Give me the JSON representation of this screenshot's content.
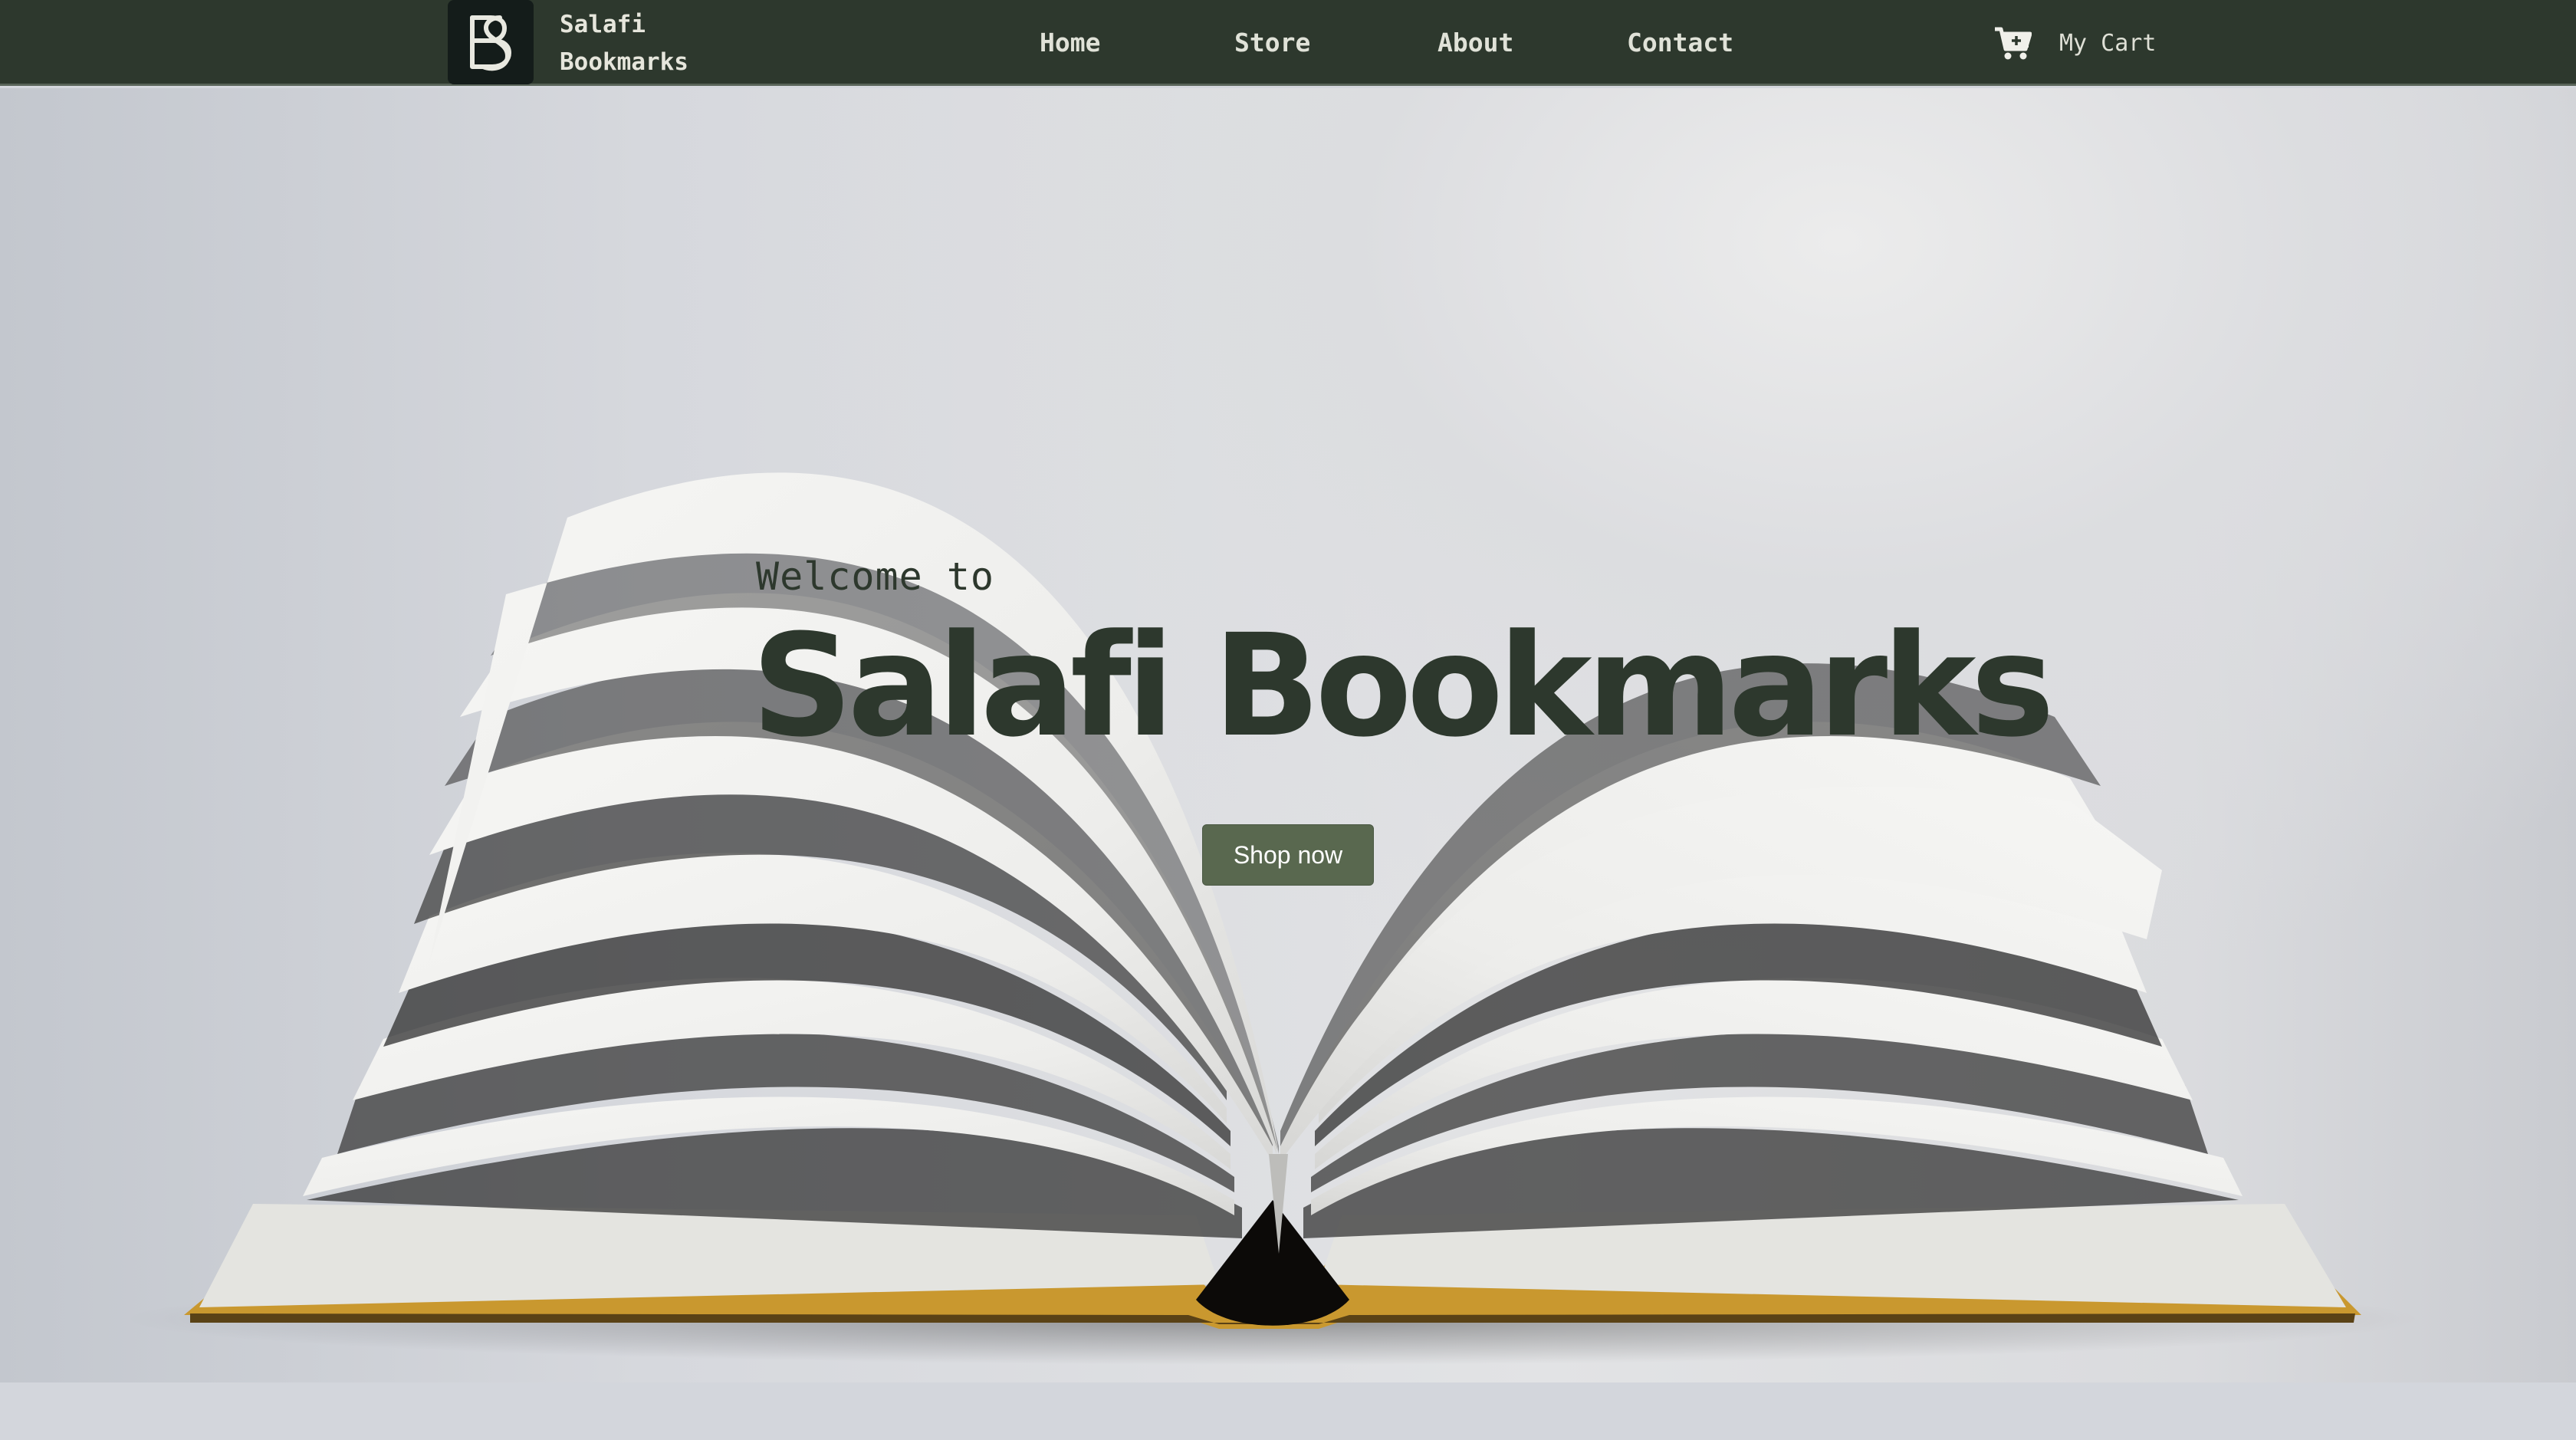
{
  "navbar": {
    "brand_line1": "Salafi",
    "brand_line2": "Bookmarks",
    "logo_icon": "bs-monogram-icon",
    "links": [
      {
        "label": "Home"
      },
      {
        "label": "Store"
      },
      {
        "label": "About"
      },
      {
        "label": "Contact"
      }
    ],
    "cart_icon": "shopping-cart-icon",
    "cart_label": "My Cart"
  },
  "hero": {
    "welcome": "Welcome to",
    "title": "Salafi Bookmarks",
    "cta_label": "Shop now",
    "background_image": "open-book-illustration"
  },
  "colors": {
    "nav_bg": "#2d382d",
    "accent": "#59684f",
    "title_text": "#2d382d",
    "hero_bg": "#dcdde0"
  }
}
